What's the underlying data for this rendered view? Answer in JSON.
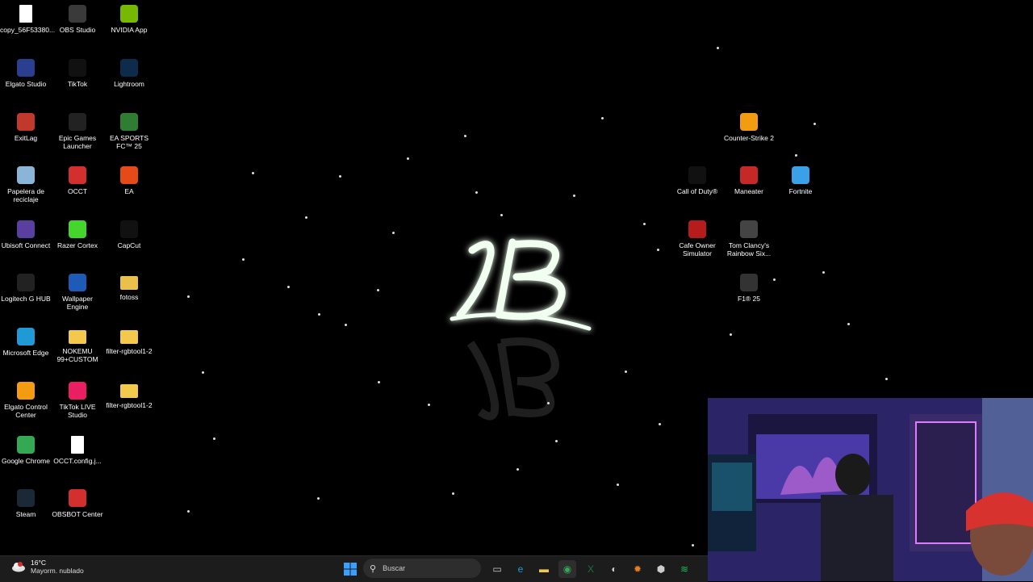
{
  "desktop": {
    "icons": [
      {
        "label": "copy_56F53380...",
        "icon": "video-file-icon",
        "color": "#ffffff"
      },
      {
        "label": "OBS Studio",
        "icon": "obs-icon",
        "color": "#3a3a3a"
      },
      {
        "label": "NVIDIA App",
        "icon": "nvidia-icon",
        "color": "#76b900"
      },
      {
        "label": "Elgato Studio",
        "icon": "elgato-studio-icon",
        "color": "#2a3f8f"
      },
      {
        "label": "TikTok",
        "icon": "tiktok-icon",
        "color": "#111111"
      },
      {
        "label": "Lightroom",
        "icon": "lightroom-icon",
        "color": "#0d2b4a"
      },
      {
        "label": "ExitLag",
        "icon": "exitlag-icon",
        "color": "#c0392b"
      },
      {
        "label": "Epic Games Launcher",
        "icon": "epic-games-icon",
        "color": "#222222"
      },
      {
        "label": "EA SPORTS FC™ 25",
        "icon": "ea-fc-icon",
        "color": "#2e7d32"
      },
      {
        "label": "Papelera de reciclaje",
        "icon": "recycle-bin-icon",
        "color": "#8ab4d8"
      },
      {
        "label": "OCCT",
        "icon": "occt-icon",
        "color": "#d32f2f"
      },
      {
        "label": "EA",
        "icon": "ea-icon",
        "color": "#e64a19"
      },
      {
        "label": "Ubisoft Connect",
        "icon": "ubisoft-icon",
        "color": "#5a3fa0"
      },
      {
        "label": "Razer Cortex",
        "icon": "razer-cortex-icon",
        "color": "#44d62c"
      },
      {
        "label": "CapCut",
        "icon": "capcut-icon",
        "color": "#111111"
      },
      {
        "label": "Logitech G HUB",
        "icon": "logitech-icon",
        "color": "#222222"
      },
      {
        "label": "Wallpaper Engine",
        "icon": "wallpaper-engine-icon",
        "color": "#1e5bb8"
      },
      {
        "label": "fotoss",
        "icon": "folder-icon",
        "color": "#e8c04a"
      },
      {
        "label": "Microsoft Edge",
        "icon": "edge-icon",
        "color": "#1f9ad6"
      },
      {
        "label": "NOKEMU 99+CUSTOM",
        "icon": "folder-icon",
        "color": "#f2c94c"
      },
      {
        "label": "filter-rgbtool1-2",
        "icon": "folder-icon",
        "color": "#f2c94c"
      },
      {
        "label": "Elgato Control Center",
        "icon": "elgato-control-icon",
        "color": "#f39c12"
      },
      {
        "label": "TikTok LIVE Studio",
        "icon": "tiktok-live-icon",
        "color": "#e91e63"
      },
      {
        "label": "filter-rgbtool1-2",
        "icon": "folder-icon",
        "color": "#f2c94c"
      },
      {
        "label": "Google Chrome",
        "icon": "chrome-icon",
        "color": "#34a853"
      },
      {
        "label": "OCCT.config.j...",
        "icon": "file-icon",
        "color": "#ffffff"
      },
      {
        "label": "Steam",
        "icon": "steam-icon",
        "color": "#1b2838"
      },
      {
        "label": "OBSBOT Center",
        "icon": "obsbot-icon",
        "color": "#d32f2f"
      },
      {
        "label": "Counter-Strike 2",
        "icon": "cs2-icon",
        "color": "#f39c12"
      },
      {
        "label": "Call of Duty®",
        "icon": "cod-icon",
        "color": "#111111"
      },
      {
        "label": "Maneater",
        "icon": "maneater-icon",
        "color": "#c62828"
      },
      {
        "label": "Fortnite",
        "icon": "fortnite-icon",
        "color": "#3aa0e8"
      },
      {
        "label": "Cafe Owner Simulator",
        "icon": "cafe-owner-icon",
        "color": "#b71c1c"
      },
      {
        "label": "Tom Clancy's Rainbow Six...",
        "icon": "rainbow-six-icon",
        "color": "#444444"
      },
      {
        "label": "F1® 25",
        "icon": "f1-icon",
        "color": "#333333"
      }
    ]
  },
  "taskbar": {
    "weather": {
      "temp": "16°C",
      "condition": "Mayorm. nublado",
      "icon": "weather-cloud-icon"
    },
    "search_placeholder": "Buscar",
    "apps": [
      {
        "icon": "windows-start-icon",
        "color": "#3aa0ff"
      },
      {
        "icon": "task-view-icon",
        "color": "#cccccc"
      },
      {
        "icon": "edge-icon",
        "color": "#1f9ad6"
      },
      {
        "icon": "file-explorer-icon",
        "color": "#f2c94c"
      },
      {
        "icon": "chrome-icon",
        "color": "#34a853"
      },
      {
        "icon": "excel-icon",
        "color": "#1d6f42"
      },
      {
        "icon": "obs-taskbar-icon",
        "color": "#cccccc"
      },
      {
        "icon": "settings-gear-icon",
        "color": "#e67e22"
      },
      {
        "icon": "steam-taskbar-icon",
        "color": "#cccccc"
      },
      {
        "icon": "spotify-icon",
        "color": "#1db954"
      }
    ]
  }
}
